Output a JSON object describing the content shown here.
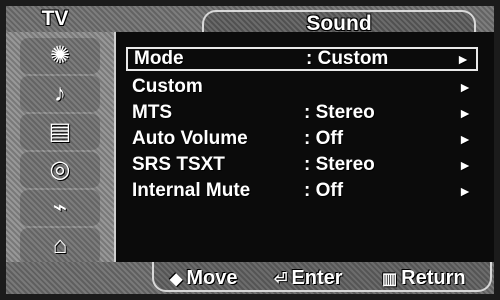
{
  "header": {
    "left_title": "TV",
    "tab_title": "Sound"
  },
  "sidebar": {
    "icons": [
      {
        "name": "picture-icon",
        "glyph": "✺"
      },
      {
        "name": "sound-icon",
        "glyph": "♪"
      },
      {
        "name": "channel-icon",
        "glyph": "▤"
      },
      {
        "name": "setup-icon",
        "glyph": "◎"
      },
      {
        "name": "input-icon",
        "glyph": "⌁"
      },
      {
        "name": "more-icon",
        "glyph": "⌂"
      }
    ]
  },
  "menu": {
    "items": [
      {
        "label": "Mode",
        "value": ": Custom",
        "arrow": "►",
        "selected": true
      },
      {
        "label": "Custom",
        "value": "",
        "arrow": "►",
        "selected": false
      },
      {
        "label": "MTS",
        "value": ": Stereo",
        "arrow": "►",
        "selected": false
      },
      {
        "label": "Auto Volume",
        "value": ": Off",
        "arrow": "►",
        "selected": false
      },
      {
        "label": "SRS TSXT",
        "value": ": Stereo",
        "arrow": "►",
        "selected": false
      },
      {
        "label": "Internal Mute",
        "value": ": Off",
        "arrow": "►",
        "selected": false
      }
    ]
  },
  "footer": {
    "move": {
      "icon": "◆",
      "label": "Move"
    },
    "enter": {
      "icon": "⏎",
      "label": "Enter"
    },
    "return": {
      "icon": "▥",
      "label": "Return"
    }
  }
}
